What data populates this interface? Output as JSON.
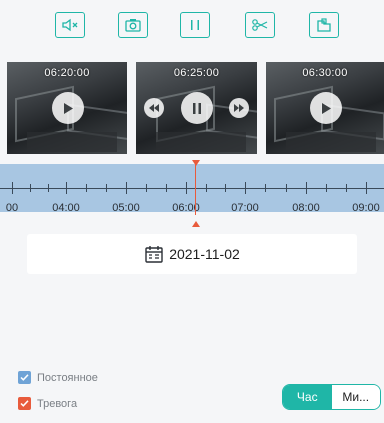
{
  "toolbar": {
    "buttons": [
      {
        "name": "mute-button",
        "icon": "speaker-mute-icon"
      },
      {
        "name": "snapshot-button",
        "icon": "camera-icon"
      },
      {
        "name": "pause-button",
        "icon": "pause-icon"
      },
      {
        "name": "clip-button",
        "icon": "scissors-icon"
      },
      {
        "name": "export-button",
        "icon": "export-icon"
      }
    ]
  },
  "thumbnails": [
    {
      "time": "06:20:00",
      "overlay": "play-icon"
    },
    {
      "time": "06:25:00",
      "overlay": "pause-icon"
    },
    {
      "time": "06:30:00",
      "overlay": "play-icon"
    }
  ],
  "timeline": {
    "labels": [
      "00",
      "04:00",
      "05:00",
      "06:00",
      "07:00",
      "08:00",
      "09:00"
    ]
  },
  "date": {
    "value": "2021-11-02"
  },
  "legend": {
    "continuous": "Постоянное",
    "alarm": "Тревога"
  },
  "scale_toggle": {
    "hour": "Час",
    "minute": "Ми..."
  },
  "colors": {
    "accent": "#1fb6a7",
    "timeline_bg": "#a8c6e2",
    "cursor": "#e85b3c",
    "continuous_check": "#6fa3d6",
    "alarm_check": "#e85b3c"
  }
}
